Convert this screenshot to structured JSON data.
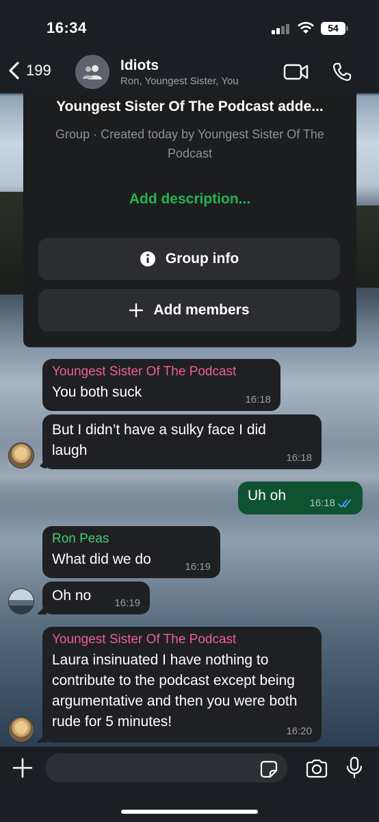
{
  "status": {
    "time": "16:34",
    "battery": "54"
  },
  "header": {
    "back_count": "199",
    "group_name": "Idiots",
    "members": "Ron, Youngest Sister, You",
    "icons": [
      "chevron-left-icon",
      "group-avatar-icon",
      "video-call-icon",
      "phone-icon"
    ]
  },
  "info_card": {
    "title": "Youngest Sister Of The Podcast adde...",
    "subtitle": "Group · Created today by Youngest Sister Of The Podcast",
    "add_description": "Add description...",
    "group_info": "Group info",
    "add_members": "Add members"
  },
  "messages": [
    {
      "sender": "Youngest Sister Of The Podcast",
      "text": "You both suck",
      "time": "16:18",
      "direction": "in"
    },
    {
      "sender": "",
      "text": "But I didn’t have a sulky face I did laugh",
      "time": "16:18",
      "direction": "in"
    },
    {
      "sender": "",
      "text": "Uh oh",
      "time": "16:18",
      "direction": "out",
      "read": true
    },
    {
      "sender": "Ron Peas",
      "text": "What did we do",
      "time": "16:19",
      "direction": "in"
    },
    {
      "sender": "",
      "text": "Oh no",
      "time": "16:19",
      "direction": "in"
    },
    {
      "sender": "Youngest Sister Of The Podcast",
      "text": "Laura insinuated I have nothing to contribute to the podcast except being argumentative and then you were both rude for 5 minutes!",
      "time": "16:20",
      "direction": "in"
    }
  ],
  "colors": {
    "accent_green": "#25b453",
    "sender_pink": "#ef5f8f",
    "sender_green": "#3fd070",
    "outgoing_bubble": "#0f5232",
    "incoming_bubble": "#1f2023"
  }
}
